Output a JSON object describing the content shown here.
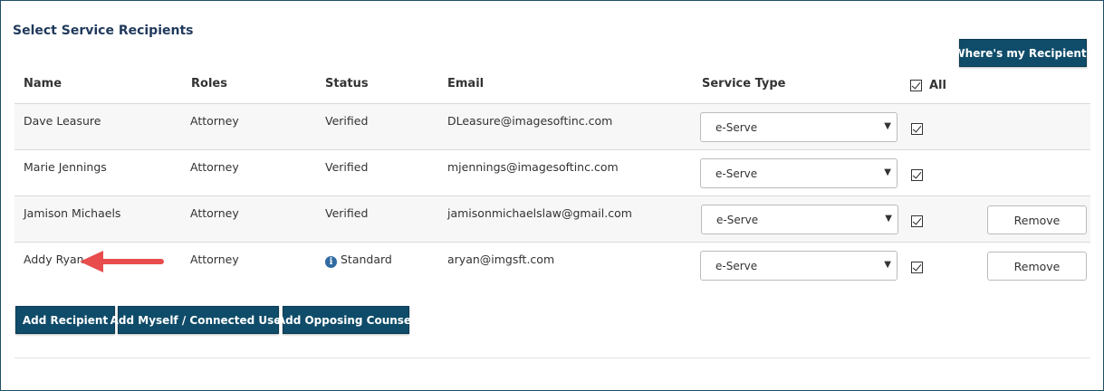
{
  "title": "Select Service Recipients",
  "where_button": "Where's my Recipient?",
  "columns": {
    "name": "Name",
    "roles": "Roles",
    "status": "Status",
    "email": "Email",
    "service_type": "Service Type",
    "all": "All"
  },
  "rows": [
    {
      "name": "Dave Leasure",
      "role": "Attorney",
      "status": "Verified",
      "email": "DLeasure@imagesoftinc.com",
      "service_type": "e-Serve",
      "checked": true,
      "remove": ""
    },
    {
      "name": "Marie Jennings",
      "role": "Attorney",
      "status": "Verified",
      "email": "mjennings@imagesoftinc.com",
      "service_type": "e-Serve",
      "checked": true,
      "remove": ""
    },
    {
      "name": "Jamison Michaels",
      "role": "Attorney",
      "status": "Verified",
      "email": "jamisonmichaelslaw@gmail.com",
      "service_type": "e-Serve",
      "checked": true,
      "remove": "Remove"
    },
    {
      "name": "Addy Ryan",
      "role": "Attorney",
      "status": "Standard",
      "email": "aryan@imgsft.com",
      "service_type": "e-Serve",
      "checked": true,
      "remove": "Remove",
      "status_icon": "info-icon"
    }
  ],
  "actions": {
    "add_recipient": "Add Recipient",
    "add_myself": "Add Myself / Connected User",
    "add_opposing": "Add Opposing Counsel"
  },
  "colors": {
    "primary": "#0f4c6a",
    "title": "#1f3a5c",
    "arrow": "#e84c4c",
    "info": "#2f6aa3"
  }
}
